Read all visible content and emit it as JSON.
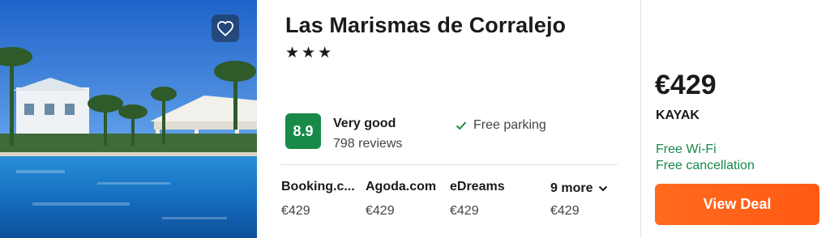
{
  "hotel": {
    "name": "Las Marismas de Corralejo",
    "stars": "★★★",
    "favorite_icon": "heart-icon",
    "rating": {
      "score": "8.9",
      "label": "Very good",
      "reviews": "798 reviews",
      "color": "#178a48"
    },
    "amenity": {
      "icon": "check-icon",
      "label": "Free parking"
    }
  },
  "providers": [
    {
      "name": "Booking.c...",
      "price": "€429"
    },
    {
      "name": "Agoda.com",
      "price": "€429"
    },
    {
      "name": "eDreams",
      "price": "€429"
    }
  ],
  "more": {
    "label": "9 more",
    "price": "€429",
    "icon": "chevron-down-icon"
  },
  "deal": {
    "price": "€429",
    "source": "KAYAK",
    "perks": [
      "Free Wi-Fi",
      "Free cancellation"
    ],
    "button_label": "View Deal",
    "button_color": "#ff5f1a",
    "perk_color": "#178a48"
  }
}
